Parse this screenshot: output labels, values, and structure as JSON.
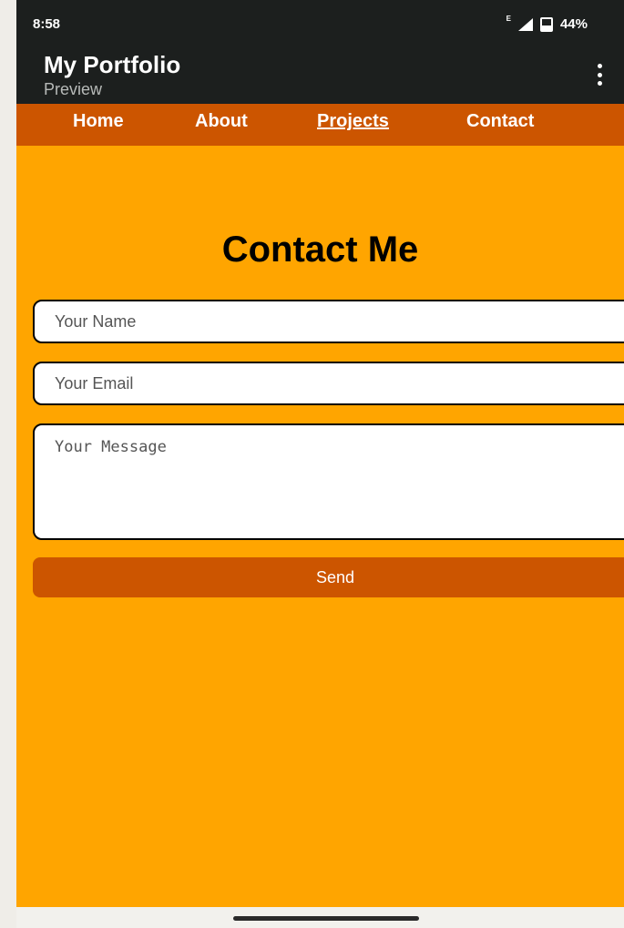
{
  "status": {
    "time": "8:58",
    "signal_label": "E",
    "battery": "44%"
  },
  "appbar": {
    "title": "My Portfolio",
    "subtitle": "Preview",
    "menu_icon": "more-vert-icon"
  },
  "nav": {
    "items": [
      {
        "label": "Home"
      },
      {
        "label": "About"
      },
      {
        "label": "Projects",
        "active": true
      },
      {
        "label": "Contact"
      }
    ]
  },
  "contact": {
    "heading": "Contact Me",
    "name_placeholder": "Your Name",
    "email_placeholder": "Your Email",
    "message_placeholder": "Your Message",
    "send_label": "Send"
  },
  "colors": {
    "page_background": "#ffa500",
    "navbar": "#cc5500",
    "appbar": "#1c1f1e",
    "button": "#cc5500"
  }
}
